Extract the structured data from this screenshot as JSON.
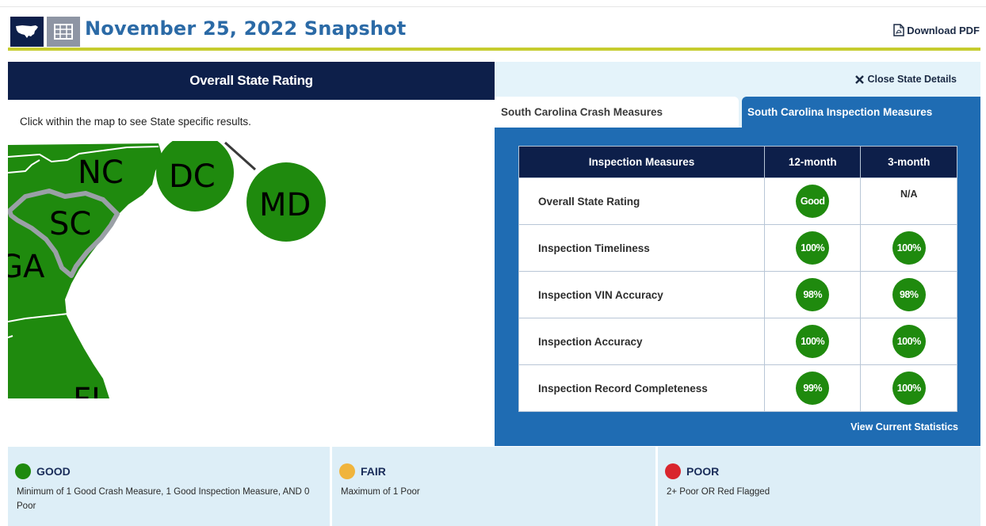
{
  "header": {
    "title": "November 25, 2022 Snapshot",
    "download_label": "Download PDF",
    "map_view_icon": "us-map-icon",
    "table_view_icon": "table-grid-icon"
  },
  "left_panel": {
    "heading": "Overall State Rating",
    "hint": "Click within the map to see State specific results.",
    "map_labels": {
      "nc": "NC",
      "sc": "SC",
      "ga": "GA",
      "dc": "DC",
      "md": "MD",
      "fl": "FL"
    }
  },
  "right_panel": {
    "close_label": "Close State Details",
    "tabs": [
      {
        "label": "South Carolina Crash Measures",
        "active": false
      },
      {
        "label": "South Carolina Inspection Measures",
        "active": true
      }
    ],
    "table": {
      "headers": [
        "Inspection Measures",
        "12-month",
        "3-month"
      ],
      "rows": [
        {
          "name": "Overall State Rating",
          "m12": "Good",
          "m3": "N/A"
        },
        {
          "name": "Inspection Timeliness",
          "m12": "100%",
          "m3": "100%"
        },
        {
          "name": "Inspection VIN Accuracy",
          "m12": "98%",
          "m3": "98%"
        },
        {
          "name": "Inspection Accuracy",
          "m12": "100%",
          "m3": "100%"
        },
        {
          "name": "Inspection Record Completeness",
          "m12": "99%",
          "m3": "100%"
        }
      ]
    },
    "view_stats_label": "View Current Statistics"
  },
  "legend": [
    {
      "label": "GOOD",
      "color": "#1f8a0e",
      "desc": "Minimum of 1 Good Crash Measure, 1 Good Inspection Measure, AND 0 Poor"
    },
    {
      "label": "FAIR",
      "color": "#f0b43c",
      "desc": "Maximum of 1 Poor"
    },
    {
      "label": "POOR",
      "color": "#d9262e",
      "desc": "2+ Poor OR Red Flagged"
    }
  ],
  "colors": {
    "navy": "#0d1f4a",
    "blue": "#1f6cb3",
    "good_green": "#1f8a0e",
    "olive": "#c6cc2e",
    "title_blue": "#2b6aa6"
  }
}
